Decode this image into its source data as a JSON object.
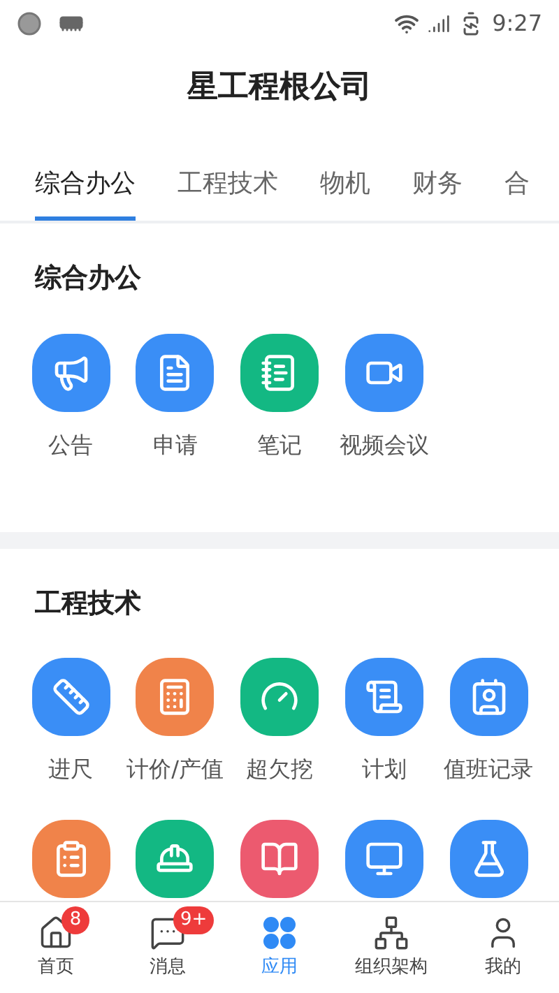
{
  "status_bar": {
    "time": "9:27"
  },
  "header": {
    "title": "星工程根公司"
  },
  "tabs": [
    {
      "label": "综合办公",
      "selected": true
    },
    {
      "label": "工程技术",
      "selected": false
    },
    {
      "label": "物机",
      "selected": false
    },
    {
      "label": "财务",
      "selected": false
    },
    {
      "label": "合",
      "selected": false
    }
  ],
  "sections": [
    {
      "title": "综合办公",
      "apps": [
        {
          "label": "公告",
          "color": "#3a8ef6",
          "kind": "notice"
        },
        {
          "label": "申请",
          "color": "#3a8ef6",
          "kind": "form"
        },
        {
          "label": "笔记",
          "color": "#13b883",
          "kind": "note"
        },
        {
          "label": "视频会议",
          "color": "#3a8ef6",
          "kind": "video"
        }
      ]
    },
    {
      "title": "工程技术",
      "apps": [
        {
          "label": "进尺",
          "color": "#3a8ef6",
          "kind": "tape"
        },
        {
          "label": "计价/产值",
          "color": "#f0834a",
          "kind": "calculator"
        },
        {
          "label": "超欠挖",
          "color": "#13b883",
          "kind": "gauge"
        },
        {
          "label": "计划",
          "color": "#3a8ef6",
          "kind": "scroll"
        },
        {
          "label": "值班记录",
          "color": "#3a8ef6",
          "kind": "badge"
        },
        {
          "color": "#f0834a",
          "kind": "clipboard"
        },
        {
          "color": "#13b883",
          "kind": "helmet"
        },
        {
          "color": "#ec5a6f",
          "kind": "book"
        },
        {
          "color": "#3a8ef6",
          "kind": "monitor"
        },
        {
          "color": "#3a8ef6",
          "kind": "flask"
        }
      ]
    }
  ],
  "bottom_nav": [
    {
      "label": "首页",
      "selected": false,
      "badge": "8",
      "kind": "home"
    },
    {
      "label": "消息",
      "selected": false,
      "badge": "9+",
      "kind": "message"
    },
    {
      "label": "应用",
      "selected": true,
      "kind": "apps"
    },
    {
      "label": "组织架构",
      "selected": false,
      "kind": "org"
    },
    {
      "label": "我的",
      "selected": false,
      "kind": "user"
    }
  ]
}
